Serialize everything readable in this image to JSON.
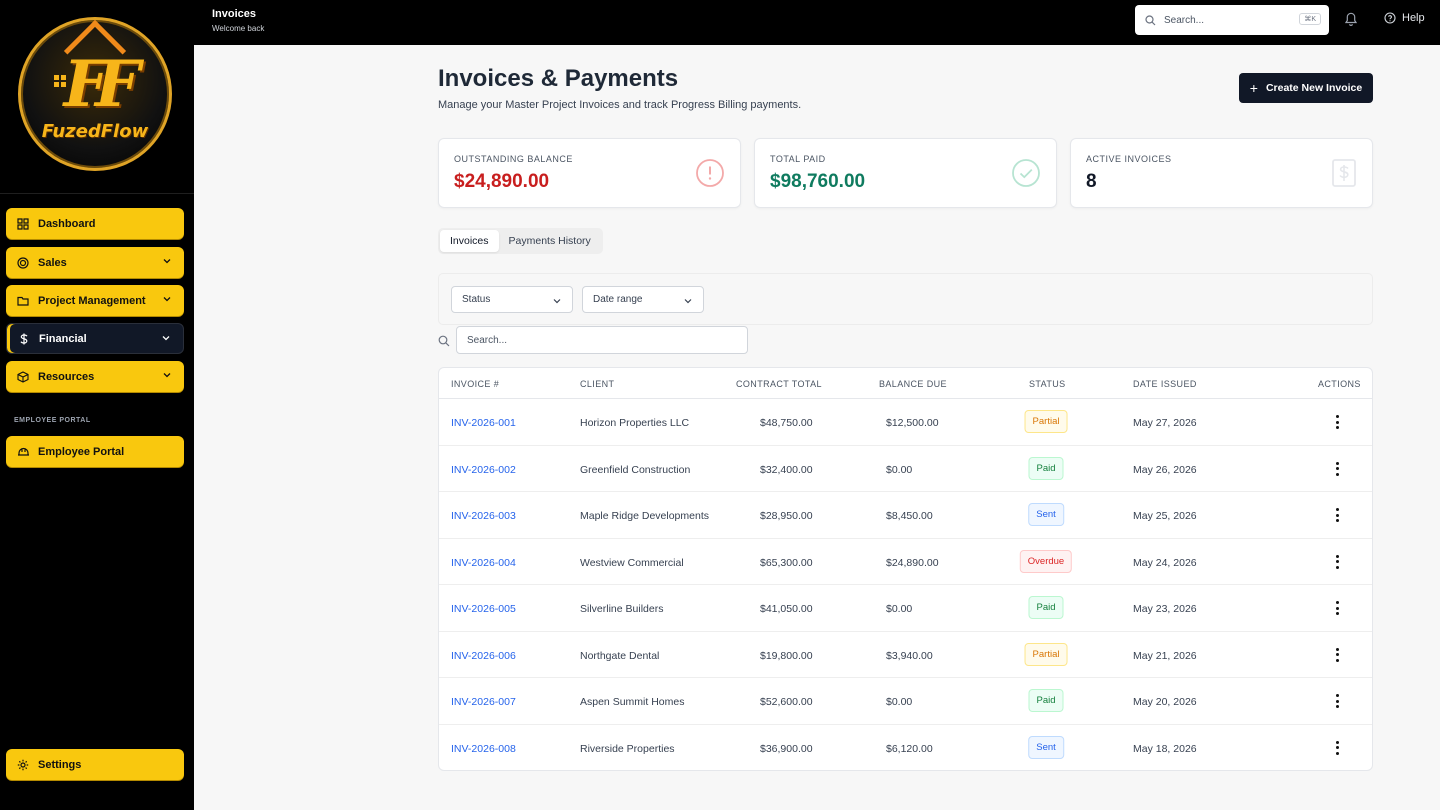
{
  "brand": {
    "name": "FuzedFlow",
    "monogram": "FF"
  },
  "sidebar": {
    "items": [
      {
        "label": "Dashboard",
        "icon": "grid-icon"
      },
      {
        "label": "Sales",
        "icon": "target-icon"
      },
      {
        "label": "Project Management",
        "icon": "folder-icon"
      },
      {
        "label": "Financial",
        "icon": "dollar-icon"
      },
      {
        "label": "Resources",
        "icon": "box-icon"
      }
    ],
    "section_label": "EMPLOYEE PORTAL",
    "portal_label": "Employee Portal",
    "settings_label": "Settings",
    "accent": "#f9c80e"
  },
  "topbar": {
    "title": "Invoices",
    "subtitle": "Welcome back",
    "search_placeholder": "Search...",
    "shortcut": "⌘K",
    "help_label": "Help"
  },
  "page": {
    "title": "Invoices & Payments",
    "subtitle": "Manage your Master Project Invoices and track Progress Billing payments.",
    "create_label": "Create New Invoice"
  },
  "cards": [
    {
      "label": "OUTSTANDING BALANCE",
      "value": "$24,890.00",
      "color": "#c81e1e",
      "icon": "alert-circle-icon"
    },
    {
      "label": "TOTAL PAID",
      "value": "$98,760.00",
      "color": "#0f7b5f",
      "icon": "check-circle-icon"
    },
    {
      "label": "ACTIVE INVOICES",
      "value": "8",
      "color": "#111827",
      "icon": "dollar-document-icon"
    }
  ],
  "tabs": [
    "Invoices",
    "Payments History"
  ],
  "filters": {
    "status_label": "Status",
    "date_label": "Date range",
    "search_placeholder": "Search..."
  },
  "table": {
    "headers": [
      "INVOICE #",
      "CLIENT",
      "CONTRACT TOTAL",
      "BALANCE DUE",
      "STATUS",
      "DATE ISSUED",
      "ACTIONS"
    ],
    "rows": [
      {
        "invoice": "INV-2026-001",
        "client": "Horizon Properties LLC",
        "total": "$48,750.00",
        "balance": "$12,500.00",
        "status": "Partial",
        "date": "May 27, 2026"
      },
      {
        "invoice": "INV-2026-002",
        "client": "Greenfield Construction",
        "total": "$32,400.00",
        "balance": "$0.00",
        "status": "Paid",
        "date": "May 26, 2026"
      },
      {
        "invoice": "INV-2026-003",
        "client": "Maple Ridge Developments",
        "total": "$28,950.00",
        "balance": "$8,450.00",
        "status": "Sent",
        "date": "May 25, 2026"
      },
      {
        "invoice": "INV-2026-004",
        "client": "Westview Commercial",
        "total": "$65,300.00",
        "balance": "$24,890.00",
        "status": "Overdue",
        "date": "May 24, 2026"
      },
      {
        "invoice": "INV-2026-005",
        "client": "Silverline Builders",
        "total": "$41,050.00",
        "balance": "$0.00",
        "status": "Paid",
        "date": "May 23, 2026"
      },
      {
        "invoice": "INV-2026-006",
        "client": "Northgate Dental",
        "total": "$19,800.00",
        "balance": "$3,940.00",
        "status": "Partial",
        "date": "May 21, 2026"
      },
      {
        "invoice": "INV-2026-007",
        "client": "Aspen Summit Homes",
        "total": "$52,600.00",
        "balance": "$0.00",
        "status": "Paid",
        "date": "May 20, 2026"
      },
      {
        "invoice": "INV-2026-008",
        "client": "Riverside Properties",
        "total": "$36,900.00",
        "balance": "$6,120.00",
        "status": "Sent",
        "date": "May 18, 2026"
      }
    ]
  }
}
